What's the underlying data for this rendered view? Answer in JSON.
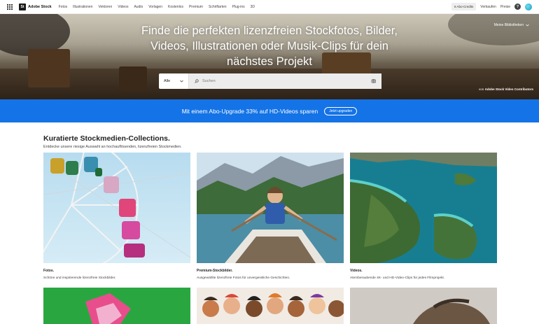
{
  "nav": {
    "logo_badge": "St",
    "logo_text": "Adobe Stock",
    "links": [
      "Fotos",
      "Illustrationen",
      "Vektoren",
      "Videos",
      "Audio",
      "Vorlagen",
      "Kostenlos",
      "Premium",
      "Schriftarten",
      "Plug-ins",
      "3D"
    ],
    "credits": "6 Abo-Credits",
    "sell": "Verkaufen",
    "pricing": "Preise",
    "help_glyph": "?"
  },
  "hero": {
    "title": "Finde die perfekten lizenzfreien Stockfotos, Bilder, Videos, Illustrationen oder Musik-Clips für dein nächstes Projekt",
    "libraries": "Meine Bibliotheken",
    "contributor_prefix": "von",
    "contributor_name": "Adobe Stock Video Contributors",
    "search": {
      "category": "Alle",
      "placeholder": "Suchen",
      "search_icon": "search-icon",
      "visual_search_icon": "camera-search-icon"
    }
  },
  "banner": {
    "text": "Mit einem Abo-Upgrade 33% auf HD-Videos sparen",
    "button": "Jetzt upgraden",
    "color": "#1473e6"
  },
  "collections": {
    "title": "Kuratierte Stockmedien-Collections.",
    "subtitle": "Entdecke unsere riesige Auswahl an hochauflösenden, lizenzfreien Stockmedien.",
    "cards": [
      {
        "label": "Fotos.",
        "desc": "Schöne und inspirierende lizenzfreie Stockbilder."
      },
      {
        "label": "Premium-Stockbilder.",
        "desc": "Ausgewählte lizenzfreie Fotos für unvergessliche Geschichten."
      },
      {
        "label": "Videos.",
        "desc": "Atemberaubende 4K- und HD-Video-Clips für jedes Filmprojekt."
      }
    ]
  }
}
